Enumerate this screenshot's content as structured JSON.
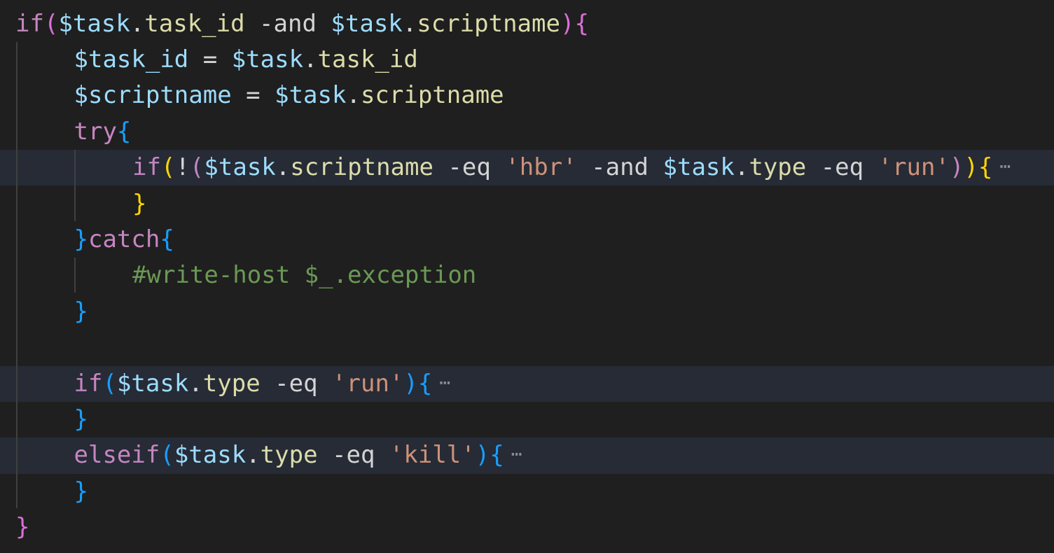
{
  "editor": {
    "language": "powershell",
    "lines": [
      {
        "n": 1,
        "indent": 0,
        "folded": false,
        "tokens": [
          {
            "t": "if",
            "c": "kw"
          },
          {
            "t": "(",
            "c": "b1"
          },
          {
            "t": "$task",
            "c": "var"
          },
          {
            "t": ".",
            "c": "op"
          },
          {
            "t": "task_id",
            "c": "prop"
          },
          {
            "t": " -and ",
            "c": "op"
          },
          {
            "t": "$task",
            "c": "var"
          },
          {
            "t": ".",
            "c": "op"
          },
          {
            "t": "scriptname",
            "c": "prop"
          },
          {
            "t": ")",
            "c": "b1"
          },
          {
            "t": "{",
            "c": "b1"
          }
        ]
      },
      {
        "n": 2,
        "indent": 1,
        "folded": false,
        "tokens": [
          {
            "t": "$task_id",
            "c": "var"
          },
          {
            "t": " = ",
            "c": "op"
          },
          {
            "t": "$task",
            "c": "var"
          },
          {
            "t": ".",
            "c": "op"
          },
          {
            "t": "task_id",
            "c": "prop"
          }
        ]
      },
      {
        "n": 3,
        "indent": 1,
        "folded": false,
        "tokens": [
          {
            "t": "$scriptname",
            "c": "var"
          },
          {
            "t": " = ",
            "c": "op"
          },
          {
            "t": "$task",
            "c": "var"
          },
          {
            "t": ".",
            "c": "op"
          },
          {
            "t": "scriptname",
            "c": "prop"
          }
        ]
      },
      {
        "n": 4,
        "indent": 1,
        "folded": false,
        "tokens": [
          {
            "t": "try",
            "c": "kw"
          },
          {
            "t": "{",
            "c": "b3"
          }
        ]
      },
      {
        "n": 5,
        "indent": 2,
        "folded": true,
        "tokens": [
          {
            "t": "if",
            "c": "kw"
          },
          {
            "t": "(",
            "c": "b2"
          },
          {
            "t": "!",
            "c": "op"
          },
          {
            "t": "(",
            "c": "b4"
          },
          {
            "t": "$task",
            "c": "var"
          },
          {
            "t": ".",
            "c": "op"
          },
          {
            "t": "scriptname",
            "c": "prop"
          },
          {
            "t": " -eq ",
            "c": "op"
          },
          {
            "t": "'hbr'",
            "c": "str"
          },
          {
            "t": " -and ",
            "c": "op"
          },
          {
            "t": "$task",
            "c": "var"
          },
          {
            "t": ".",
            "c": "op"
          },
          {
            "t": "type",
            "c": "prop"
          },
          {
            "t": " -eq ",
            "c": "op"
          },
          {
            "t": "'run'",
            "c": "str"
          },
          {
            "t": ")",
            "c": "b4"
          },
          {
            "t": ")",
            "c": "b2"
          },
          {
            "t": "{",
            "c": "b2"
          }
        ]
      },
      {
        "n": 6,
        "indent": 2,
        "folded": false,
        "tokens": [
          {
            "t": "}",
            "c": "b2"
          }
        ]
      },
      {
        "n": 7,
        "indent": 1,
        "folded": false,
        "tokens": [
          {
            "t": "}",
            "c": "b3"
          },
          {
            "t": "catch",
            "c": "kw"
          },
          {
            "t": "{",
            "c": "b3"
          }
        ]
      },
      {
        "n": 8,
        "indent": 2,
        "folded": false,
        "tokens": [
          {
            "t": "#write-host $_.exception",
            "c": "cmt"
          }
        ]
      },
      {
        "n": 9,
        "indent": 1,
        "folded": false,
        "tokens": [
          {
            "t": "}",
            "c": "b3"
          }
        ]
      },
      {
        "n": 10,
        "indent": 0,
        "folded": false,
        "tokens": []
      },
      {
        "n": 11,
        "indent": 1,
        "folded": true,
        "tokens": [
          {
            "t": "if",
            "c": "kw"
          },
          {
            "t": "(",
            "c": "b3"
          },
          {
            "t": "$task",
            "c": "var"
          },
          {
            "t": ".",
            "c": "op"
          },
          {
            "t": "type",
            "c": "prop"
          },
          {
            "t": " -eq ",
            "c": "op"
          },
          {
            "t": "'run'",
            "c": "str"
          },
          {
            "t": ")",
            "c": "b3"
          },
          {
            "t": "{",
            "c": "b3"
          }
        ]
      },
      {
        "n": 12,
        "indent": 1,
        "folded": false,
        "tokens": [
          {
            "t": "}",
            "c": "b3"
          }
        ]
      },
      {
        "n": 13,
        "indent": 1,
        "folded": true,
        "tokens": [
          {
            "t": "elseif",
            "c": "kw"
          },
          {
            "t": "(",
            "c": "b3"
          },
          {
            "t": "$task",
            "c": "var"
          },
          {
            "t": ".",
            "c": "op"
          },
          {
            "t": "type",
            "c": "prop"
          },
          {
            "t": " -eq ",
            "c": "op"
          },
          {
            "t": "'kill'",
            "c": "str"
          },
          {
            "t": ")",
            "c": "b3"
          },
          {
            "t": "{",
            "c": "b3"
          }
        ]
      },
      {
        "n": 14,
        "indent": 1,
        "folded": false,
        "tokens": [
          {
            "t": "}",
            "c": "b3"
          }
        ]
      },
      {
        "n": 15,
        "indent": 0,
        "folded": false,
        "tokens": [
          {
            "t": "}",
            "c": "b1"
          }
        ]
      }
    ],
    "fold_marker": "⋯"
  },
  "colors": {
    "background": "#1f1f1f",
    "folded_line_bg": "#262b36",
    "keyword": "#c586c0",
    "variable": "#9cdcfe",
    "property": "#dcdcaa",
    "string": "#ce9178",
    "comment": "#6a9955",
    "bracket_level_1": "#da70d6",
    "bracket_level_2": "#ffd700",
    "bracket_level_3": "#179fff"
  }
}
